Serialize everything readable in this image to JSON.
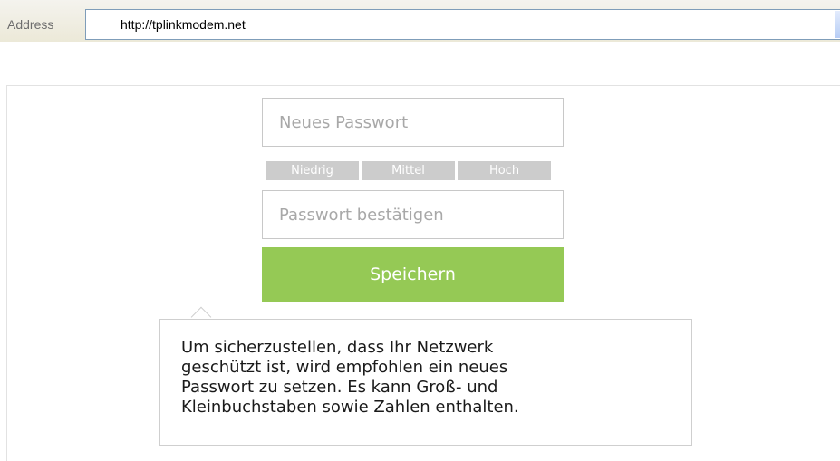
{
  "browser": {
    "address_label": "Address",
    "url": "http://tplinkmodem.net",
    "dropdown_icon": "chevron-down-icon"
  },
  "form": {
    "new_password_placeholder": "Neues Passwort",
    "strength_levels": [
      "Niedrig",
      "Mittel",
      "Hoch"
    ],
    "confirm_password_placeholder": "Passwort bestätigen",
    "save_label": "Speichern"
  },
  "tooltip": {
    "lines": [
      "Um sicherzustellen, dass Ihr Netzwerk",
      "geschützt ist, wird empfohlen ein neues",
      "Passwort zu setzen. Es kann Groß- und",
      "Kleinbuchstaben sowie Zahlen enthalten."
    ]
  },
  "colors": {
    "save_button": "#95c955",
    "strength_inactive": "#cccccc"
  }
}
